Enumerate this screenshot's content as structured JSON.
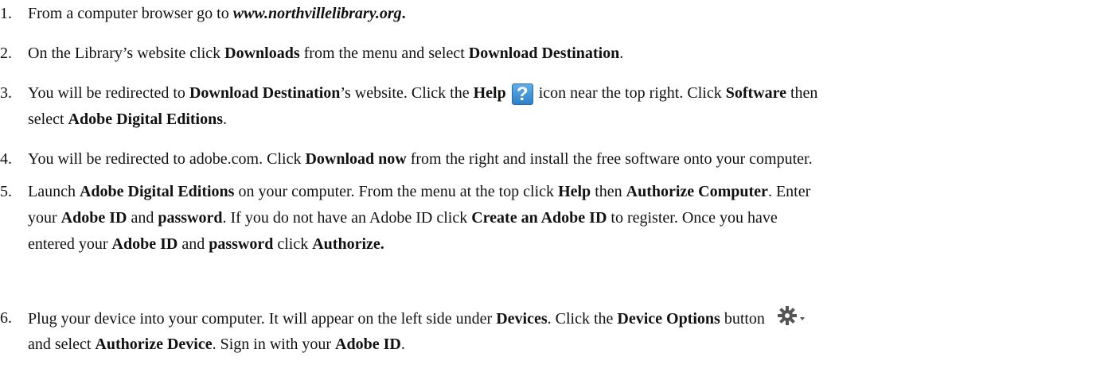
{
  "steps": [
    {
      "number": "1.",
      "s1": "From a computer browser go to ",
      "url": "www.northvillelibrary.org",
      "s2": "."
    },
    {
      "number": "2.",
      "s1": "On the Library’s website click ",
      "b1": "Downloads",
      "s2": " from the menu and select ",
      "b2": "Download Destination",
      "s3": "."
    },
    {
      "number": "3.",
      "s1": "You will be redirected to ",
      "b1": "Download Destination",
      "s2": "’s website. Click the ",
      "b2": "Help",
      "icon_glyph": "?",
      "icon_name": "help-icon",
      "s3": " icon near the top right. Click ",
      "b3": "Software",
      "s4": " then",
      "s5": "select ",
      "b4": "Adobe Digital Editions",
      "s6": "."
    },
    {
      "number": "4.",
      "s1": "You will be redirected to adobe.com. Click ",
      "b1": "Download now",
      "s2": " from the right and install the free software onto your computer."
    },
    {
      "number": "5.",
      "s1": "Launch ",
      "b1": "Adobe Digital Editions",
      "s2": " on your computer. From the menu at the top click ",
      "b2": "Help",
      "s3": " then ",
      "b3": "Authorize Computer",
      "s4": ". Enter",
      "s5": "your ",
      "b4": "Adobe ID",
      "s6": " and ",
      "b5": "password",
      "s7": ". If you do not have an Adobe ID click ",
      "b6": "Create an Adobe ID",
      "s8": " to register. Once you have",
      "s9": "entered your ",
      "b7": "Adobe ID",
      "s10": " and ",
      "b8": "password",
      "s11": " click ",
      "b9": "Authorize."
    },
    {
      "number": "6.",
      "s1": "Plug your device into your computer. It will appear on the left side under ",
      "b1": "Devices",
      "s2": ". Click the ",
      "b2": "Device Options",
      "s3": " button",
      "icon_name": "gear-dropdown-icon",
      "s4": "and select ",
      "b3": "Authorize Device",
      "s5": ". Sign in with your ",
      "b4": "Adobe ID",
      "s6": "."
    }
  ]
}
